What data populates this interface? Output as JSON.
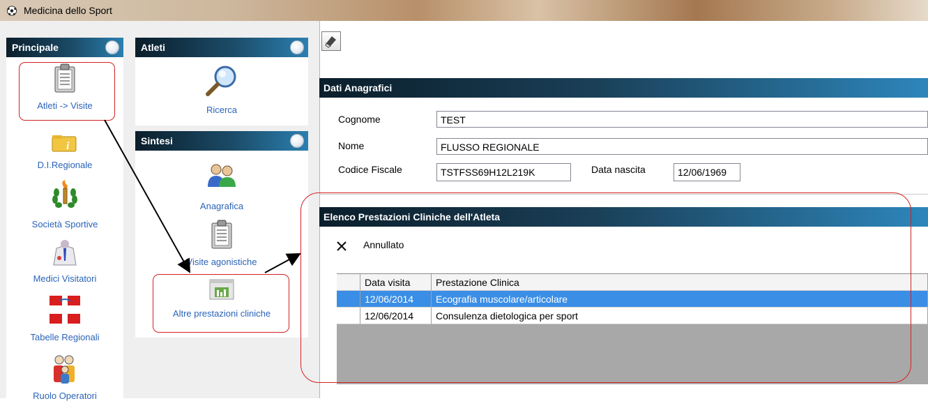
{
  "window": {
    "title": "Medicina dello Sport"
  },
  "panels": {
    "principale": {
      "title": "Principale",
      "items": [
        {
          "label": "Atleti -> Visite",
          "icon": "clipboard-icon"
        },
        {
          "label": "D.I.Regionale",
          "icon": "info-folder-icon"
        },
        {
          "label": "Società Sportive",
          "icon": "torch-laurel-icon"
        },
        {
          "label": "Medici Visitatori",
          "icon": "doctor-icon"
        },
        {
          "label": "Tabelle Regionali",
          "icon": "regional-flag-icon"
        },
        {
          "label": "Ruolo Operatori",
          "icon": "group-users-icon"
        }
      ]
    },
    "atleti": {
      "title": "Atleti",
      "items": [
        {
          "label": "Ricerca",
          "icon": "magnifier-icon"
        }
      ]
    },
    "sintesi": {
      "title": "Sintesi",
      "items": [
        {
          "label": "Anagrafica",
          "icon": "users-icon"
        },
        {
          "label": "Visite agonistiche",
          "icon": "clipboard-icon"
        },
        {
          "label": "Altre prestazioni cliniche",
          "icon": "chart-window-icon"
        }
      ]
    }
  },
  "dati_anagrafici": {
    "title": "Dati Anagrafici",
    "cognome_label": "Cognome",
    "cognome_value": "TEST",
    "nome_label": "Nome",
    "nome_value": "FLUSSO REGIONALE",
    "cf_label": "Codice Fiscale",
    "cf_value": "TSTFSS69H12L219K",
    "nascita_label": "Data nascita",
    "nascita_value": "12/06/1969"
  },
  "elenco": {
    "title": "Elenco Prestazioni Cliniche dell'Atleta",
    "annullato_label": "Annullato",
    "columns": [
      "Data visita",
      "Prestazione Clinica"
    ],
    "rows": [
      {
        "data": "12/06/2014",
        "prestazione": "Ecografia muscolare/articolare",
        "selected": true
      },
      {
        "data": "12/06/2014",
        "prestazione": "Consulenza dietologica per sport",
        "selected": false
      }
    ]
  },
  "colors": {
    "header_dark": "#0b1e2b",
    "header_light": "#2d86bb",
    "link_blue": "#2a63b8",
    "selection": "#3a8ee6",
    "annotation_red": "#d42020"
  }
}
